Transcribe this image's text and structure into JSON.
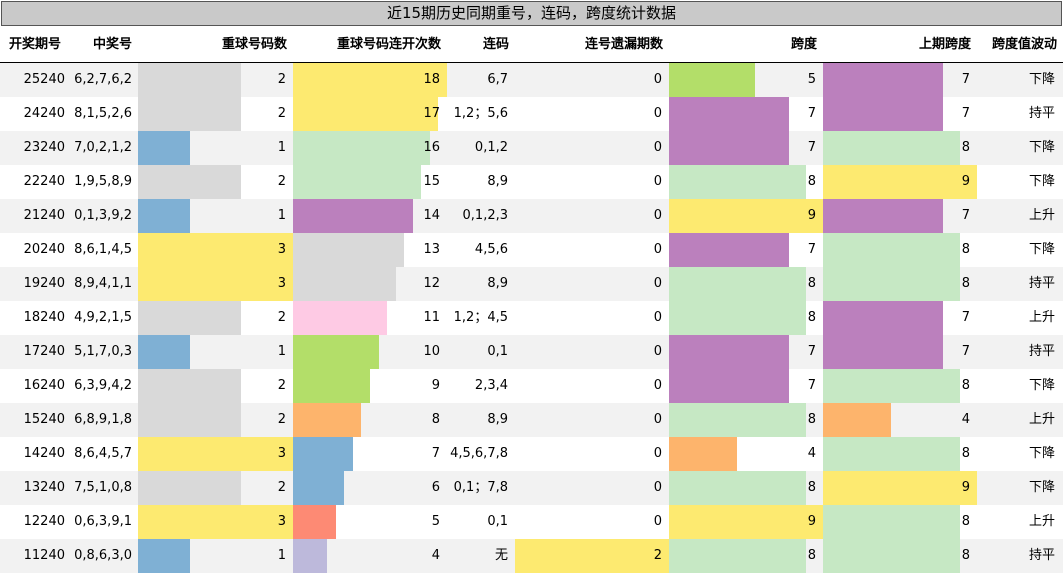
{
  "title": "近15期历史同期重号，连码，跨度统计数据",
  "headers": [
    "开奖期号",
    "中奖号",
    "重球号码数",
    "重球号码连开次数",
    "连码",
    "连号遗漏期数",
    "跨度",
    "上期跨度",
    "跨度值波动"
  ],
  "colors": {
    "gray": "#d9d9d9",
    "blue": "#7fb0d4",
    "yellow": "#fdea70",
    "green": "#c6e8c4",
    "purple": "#bb80bd",
    "pink": "#fecae4",
    "lime": "#b3de69",
    "orange": "#fdb46c",
    "salmon": "#fd8a74",
    "lavender": "#bdb9db"
  },
  "rows": [
    {
      "period": "25240",
      "numbers": "6,2,7,6,2",
      "repeat": 2,
      "repeat_color": "gray",
      "streak": 18,
      "streak_color": "yellow",
      "lianma": "6,7",
      "miss": 0,
      "miss_color": "",
      "span": 5,
      "span_color": "lime",
      "prev_span": 7,
      "prev_span_color": "purple",
      "trend": "下降"
    },
    {
      "period": "24240",
      "numbers": "8,1,5,2,6",
      "repeat": 2,
      "repeat_color": "gray",
      "streak": 17,
      "streak_color": "yellow",
      "lianma": "1,2；5,6",
      "miss": 0,
      "miss_color": "",
      "span": 7,
      "span_color": "purple",
      "prev_span": 7,
      "prev_span_color": "purple",
      "trend": "持平"
    },
    {
      "period": "23240",
      "numbers": "7,0,2,1,2",
      "repeat": 1,
      "repeat_color": "blue",
      "streak": 16,
      "streak_color": "green",
      "lianma": "0,1,2",
      "miss": 0,
      "miss_color": "",
      "span": 7,
      "span_color": "purple",
      "prev_span": 8,
      "prev_span_color": "green",
      "trend": "下降"
    },
    {
      "period": "22240",
      "numbers": "1,9,5,8,9",
      "repeat": 2,
      "repeat_color": "gray",
      "streak": 15,
      "streak_color": "green",
      "lianma": "8,9",
      "miss": 0,
      "miss_color": "",
      "span": 8,
      "span_color": "green",
      "prev_span": 9,
      "prev_span_color": "yellow",
      "trend": "下降"
    },
    {
      "period": "21240",
      "numbers": "0,1,3,9,2",
      "repeat": 1,
      "repeat_color": "blue",
      "streak": 14,
      "streak_color": "purple",
      "lianma": "0,1,2,3",
      "miss": 0,
      "miss_color": "",
      "span": 9,
      "span_color": "yellow",
      "prev_span": 7,
      "prev_span_color": "purple",
      "trend": "上升"
    },
    {
      "period": "20240",
      "numbers": "8,6,1,4,5",
      "repeat": 3,
      "repeat_color": "yellow",
      "streak": 13,
      "streak_color": "gray",
      "lianma": "4,5,6",
      "miss": 0,
      "miss_color": "",
      "span": 7,
      "span_color": "purple",
      "prev_span": 8,
      "prev_span_color": "green",
      "trend": "下降"
    },
    {
      "period": "19240",
      "numbers": "8,9,4,1,1",
      "repeat": 3,
      "repeat_color": "yellow",
      "streak": 12,
      "streak_color": "gray",
      "lianma": "8,9",
      "miss": 0,
      "miss_color": "",
      "span": 8,
      "span_color": "green",
      "prev_span": 8,
      "prev_span_color": "green",
      "trend": "持平"
    },
    {
      "period": "18240",
      "numbers": "4,9,2,1,5",
      "repeat": 2,
      "repeat_color": "gray",
      "streak": 11,
      "streak_color": "pink",
      "lianma": "1,2；4,5",
      "miss": 0,
      "miss_color": "",
      "span": 8,
      "span_color": "green",
      "prev_span": 7,
      "prev_span_color": "purple",
      "trend": "上升"
    },
    {
      "period": "17240",
      "numbers": "5,1,7,0,3",
      "repeat": 1,
      "repeat_color": "blue",
      "streak": 10,
      "streak_color": "lime",
      "lianma": "0,1",
      "miss": 0,
      "miss_color": "",
      "span": 7,
      "span_color": "purple",
      "prev_span": 7,
      "prev_span_color": "purple",
      "trend": "持平"
    },
    {
      "period": "16240",
      "numbers": "6,3,9,4,2",
      "repeat": 2,
      "repeat_color": "gray",
      "streak": 9,
      "streak_color": "lime",
      "lianma": "2,3,4",
      "miss": 0,
      "miss_color": "",
      "span": 7,
      "span_color": "purple",
      "prev_span": 8,
      "prev_span_color": "green",
      "trend": "下降"
    },
    {
      "period": "15240",
      "numbers": "6,8,9,1,8",
      "repeat": 2,
      "repeat_color": "gray",
      "streak": 8,
      "streak_color": "orange",
      "lianma": "8,9",
      "miss": 0,
      "miss_color": "",
      "span": 8,
      "span_color": "green",
      "prev_span": 4,
      "prev_span_color": "orange",
      "trend": "上升"
    },
    {
      "period": "14240",
      "numbers": "8,6,4,5,7",
      "repeat": 3,
      "repeat_color": "yellow",
      "streak": 7,
      "streak_color": "blue",
      "lianma": "4,5,6,7,8",
      "miss": 0,
      "miss_color": "",
      "span": 4,
      "span_color": "orange",
      "prev_span": 8,
      "prev_span_color": "green",
      "trend": "下降"
    },
    {
      "period": "13240",
      "numbers": "7,5,1,0,8",
      "repeat": 2,
      "repeat_color": "gray",
      "streak": 6,
      "streak_color": "blue",
      "lianma": "0,1；7,8",
      "miss": 0,
      "miss_color": "",
      "span": 8,
      "span_color": "green",
      "prev_span": 9,
      "prev_span_color": "yellow",
      "trend": "下降"
    },
    {
      "period": "12240",
      "numbers": "0,6,3,9,1",
      "repeat": 3,
      "repeat_color": "yellow",
      "streak": 5,
      "streak_color": "salmon",
      "lianma": "0,1",
      "miss": 0,
      "miss_color": "",
      "span": 9,
      "span_color": "yellow",
      "prev_span": 8,
      "prev_span_color": "green",
      "trend": "上升"
    },
    {
      "period": "11240",
      "numbers": "0,8,6,3,0",
      "repeat": 1,
      "repeat_color": "blue",
      "streak": 4,
      "streak_color": "lavender",
      "lianma": "无",
      "miss": 2,
      "miss_color": "yellow",
      "span": 8,
      "span_color": "green",
      "prev_span": 8,
      "prev_span_color": "green",
      "trend": "持平"
    }
  ]
}
